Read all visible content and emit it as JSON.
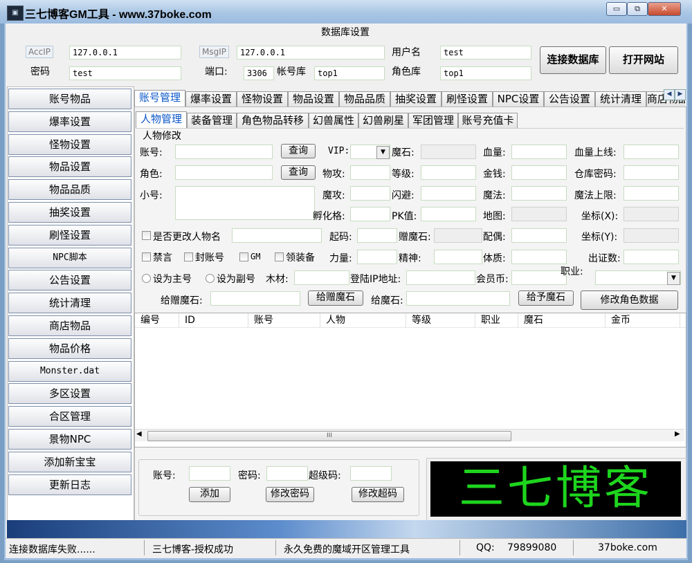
{
  "window": {
    "title": "三七博客GM工具 - www.37boke.com",
    "minimize": "▭",
    "restore": "⧉",
    "close": "✕"
  },
  "db": {
    "section_title": "数据库设置",
    "accip_label": "AccIP",
    "accip_value": "127.0.0.1",
    "msgip_label": "MsgIP",
    "msgip_value": "127.0.0.1",
    "username_label": "用户名",
    "username_value": "test",
    "password_label": "密码",
    "password_value": "test",
    "port_label": "端口:",
    "port_value": "3306",
    "account_db_label": "帐号库",
    "account_db_value": "top1",
    "role_db_label": "角色库",
    "role_db_value": "top1",
    "connect_button": "连接数据库",
    "open_site_button": "打开网站"
  },
  "menu": [
    "账号物品",
    "爆率设置",
    "怪物设置",
    "物品设置",
    "物品品质",
    "抽奖设置",
    "刷怪设置",
    "NPC脚本",
    "公告设置",
    "统计清理",
    "商店物品",
    "物品价格",
    "Monster.dat",
    "多区设置",
    "合区管理",
    "景物NPC",
    "添加新宝宝",
    "更新日志"
  ],
  "main_tabs": [
    "账号管理",
    "爆率设置",
    "怪物设置",
    "物品设置",
    "物品品质",
    "抽奖设置",
    "刷怪设置",
    "NPC设置",
    "公告设置",
    "统计清理",
    "商店物品"
  ],
  "sub_tabs": [
    "人物管理",
    "装备管理",
    "角色物品转移",
    "幻兽属性",
    "幻兽刷星",
    "军团管理",
    "账号充值卡"
  ],
  "form": {
    "group_title": "人物修改",
    "account": "账号:",
    "role": "角色:",
    "alt": "小号:",
    "query": "查询",
    "vip": "VIP:",
    "phys_atk": "物攻:",
    "magic_atk": "魔攻:",
    "hatch": "孵化格:",
    "gem": "魔石:",
    "level": "等级:",
    "dodge": "闪避:",
    "pk": "PK值:",
    "hp": "血量:",
    "money": "金钱:",
    "mp": "魔法:",
    "map": "地图:",
    "hp_max": "血量上线:",
    "warehouse_pwd": "仓库密码:",
    "mp_max": "魔法上限:",
    "coord_x": "坐标(X):",
    "coord_y": "坐标(Y):",
    "rename_chk": "是否更改人物名",
    "start_code": "起码:",
    "gift_gem": "赠魔石:",
    "spouse": "配偶:",
    "ban": "禁言",
    "ban_account": "封账号",
    "gm": "GM",
    "gear": "领装备",
    "strength": "力量:",
    "spirit": "精神:",
    "physique": "体质:",
    "cert": "出证数:",
    "set_main": "设为主号",
    "set_alt": "设为副号",
    "wood": "木材:",
    "login_ip": "登陆IP地址:",
    "member_coin": "会员币:",
    "job": "职业:",
    "give_gift_gem_label": "给赠魔石:",
    "give_gift_gem_btn": "给赠魔石",
    "give_gem_label": "给魔石:",
    "give_gem_btn": "给予魔石",
    "modify_role_btn": "修改角色数据"
  },
  "grid_headers": [
    "编号",
    "ID",
    "账号",
    "人物",
    "等级",
    "职业",
    "魔石",
    "金币"
  ],
  "scroll_thumb": "III",
  "add_account": {
    "account": "账号:",
    "password": "密码:",
    "supercode": "超级码:",
    "add_btn": "添加",
    "change_pwd_btn": "修改密码",
    "change_super_btn": "修改超码"
  },
  "logo_text": "三七博客",
  "status": {
    "connection": "连接数据库失败......",
    "auth": "三七博客-授权成功",
    "slogan": "永久免费的魔域开区管理工具",
    "qq_label": "QQ:",
    "qq_value": "79899080",
    "site": "37boke.com"
  },
  "colors": {
    "logo_green": "#1ed51e",
    "active_tab_text": "#0a55c8"
  }
}
